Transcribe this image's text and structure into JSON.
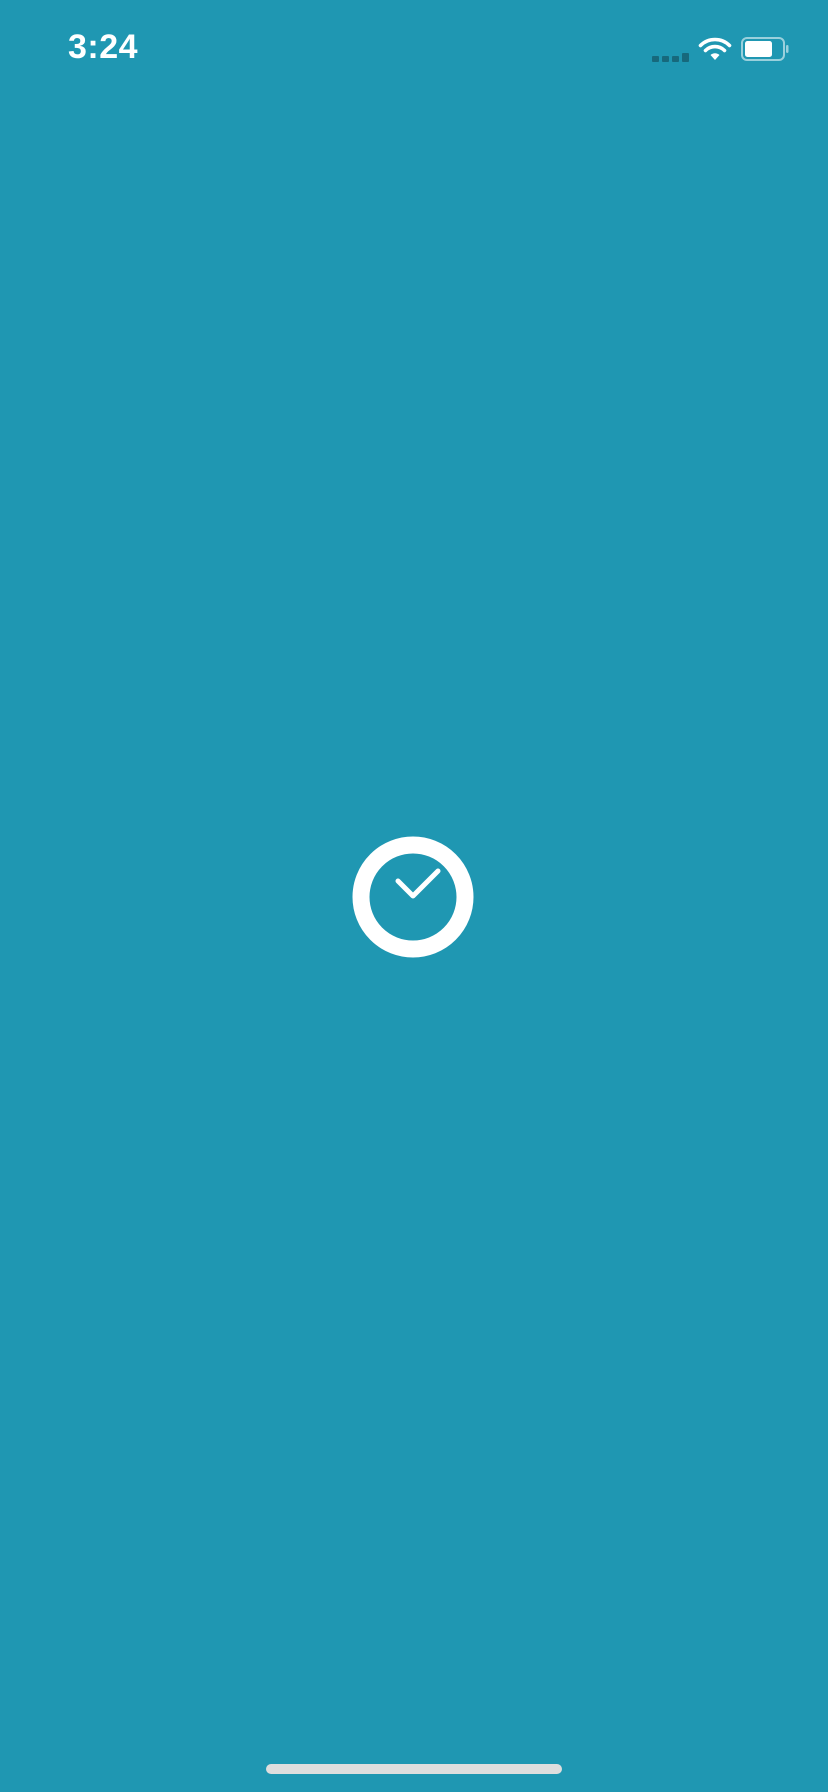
{
  "status_bar": {
    "time": "3:24",
    "icons": {
      "signal": "cellular-signal-icon",
      "wifi": "wifi-icon",
      "battery": "battery-icon"
    },
    "battery_level": 0.75
  },
  "splash": {
    "icon": "check-circle-icon"
  },
  "colors": {
    "background": "#1f97b2",
    "foreground": "#ffffff",
    "signal_inactive": "#17697c",
    "home_indicator": "#dedede"
  }
}
